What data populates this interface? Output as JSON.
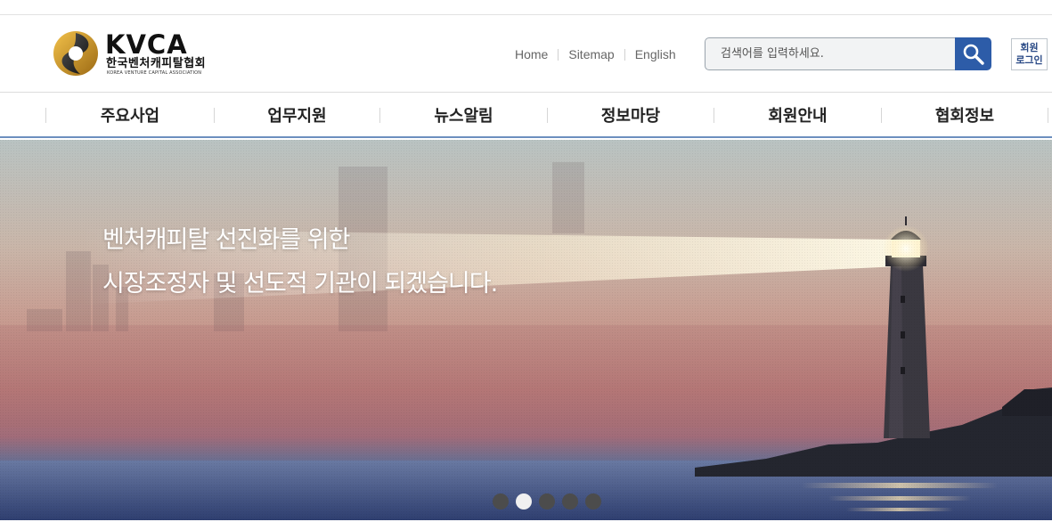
{
  "logo": {
    "en": "KVCA",
    "ko": "한국벤처캐피탈협회",
    "sub": "KOREA VENTURE CAPITAL ASSOCIATION"
  },
  "util_links": [
    "Home",
    "Sitemap",
    "English"
  ],
  "search": {
    "placeholder": "검색어를 입력하세요.",
    "button_icon": "magnifier-icon"
  },
  "login": {
    "line1": "회원",
    "line2": "로그인"
  },
  "nav": [
    {
      "label": "주요사업"
    },
    {
      "label": "업무지원"
    },
    {
      "label": "뉴스알림"
    },
    {
      "label": "정보마당"
    },
    {
      "label": "회원안내"
    },
    {
      "label": "협회정보"
    }
  ],
  "hero": {
    "line1": "벤처캐피탈 선진화를 위한",
    "line2": "시장조정자 및 선도적 기관이 되겠습니다.",
    "slide_count": 5,
    "active_slide": 2
  },
  "colors": {
    "accent": "#2d5ca8",
    "nav_border": "#6c8fbf",
    "logo_gold": "#c9962a"
  }
}
